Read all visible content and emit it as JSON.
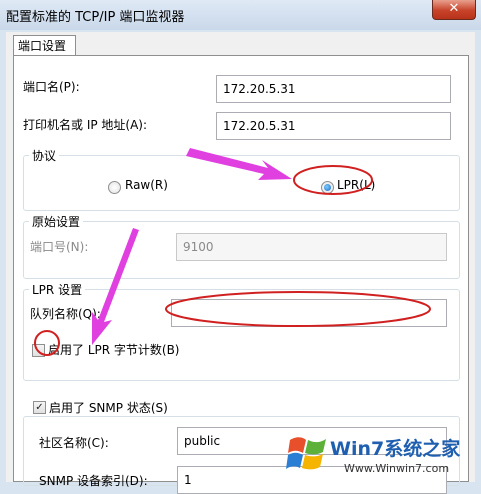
{
  "window": {
    "title": "配置标准的 TCP/IP 端口监视器",
    "close_glyph": "✕"
  },
  "tab": {
    "label": "端口设置"
  },
  "port_name": {
    "label": "端口名(P):",
    "value": "172.20.5.31"
  },
  "printer_name": {
    "label": "打印机名或 IP 地址(A):",
    "value": "172.20.5.31"
  },
  "protocol": {
    "title": "协议",
    "raw": {
      "label": "Raw(R)",
      "selected": false
    },
    "lpr": {
      "label": "LPR(L)",
      "selected": true
    }
  },
  "raw_settings": {
    "title": "原始设置",
    "port_number": {
      "label": "端口号(N):",
      "value": "9100"
    }
  },
  "lpr_settings": {
    "title": "LPR 设置",
    "queue_name": {
      "label": "队列名称(Q):",
      "value": ""
    },
    "byte_count": {
      "label": "启用了 LPR 字节计数(B)",
      "checked": false
    }
  },
  "snmp": {
    "enabled": {
      "label": "启用了 SNMP 状态(S)",
      "checked": true
    },
    "community": {
      "label": "社区名称(C):",
      "value": "public"
    },
    "device_index": {
      "label": "SNMP 设备索引(D):",
      "value": "1"
    }
  },
  "watermark": {
    "brand": "Win7系统之家",
    "url": "Www.Winwin7.com"
  },
  "annotation_color": "#e040e0",
  "circle_color": "#d02020"
}
